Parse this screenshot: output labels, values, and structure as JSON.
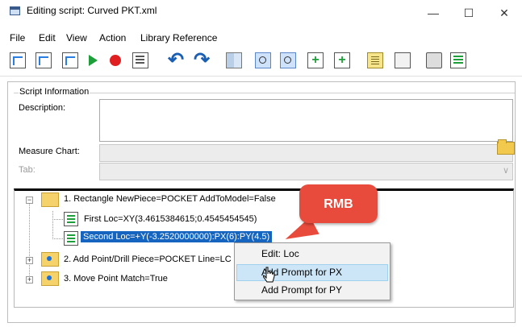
{
  "window": {
    "title": "Editing script: Curved PKT.xml",
    "minimize_glyph": "—",
    "maximize_glyph": "☐",
    "close_glyph": "✕"
  },
  "menu": {
    "items": [
      "File",
      "Edit",
      "View",
      "Action",
      "Library Reference"
    ]
  },
  "toolbar": {
    "icons": [
      "script-book-icon",
      "import-icon",
      "export-icon",
      "play-icon",
      "record-icon",
      "list-icon",
      "undo-icon",
      "redo-icon",
      "grid-icon",
      "zoom-in-icon",
      "zoom-out-icon",
      "add-step-icon",
      "add-substep-icon",
      "notes-icon",
      "edit-icon",
      "print-icon",
      "properties-icon"
    ]
  },
  "script_info": {
    "group_title": "Script Information",
    "description_label": "Description:",
    "description_value": "",
    "measure_chart_label": "Measure Chart:",
    "measure_chart_value": "",
    "tab_label": "Tab:",
    "tab_value": ""
  },
  "tree": {
    "rows": [
      {
        "label": "1. Rectangle  NewPiece=POCKET  AddToModel=False",
        "expander": "−"
      },
      {
        "label": "First  Loc=XY(3.4615384615;0.4545454545)"
      },
      {
        "label": "Second  Loc=+Y(-3.2520000000):PX(6):PY(4.5)"
      },
      {
        "label": "2. Add Point/Drill  Piece=POCKET  Line=LC",
        "expander": "+"
      },
      {
        "label": "3. Move Point  Match=True",
        "expander": "+"
      }
    ]
  },
  "callout": {
    "text": "RMB",
    "color": "#e84b3c"
  },
  "context_menu": {
    "items": [
      "Edit: Loc",
      "Add Prompt for PX",
      "Add Prompt for PY"
    ],
    "highlighted_index": 1
  },
  "colors": {
    "selection": "#1565c0",
    "highlight": "#cde6f7"
  }
}
